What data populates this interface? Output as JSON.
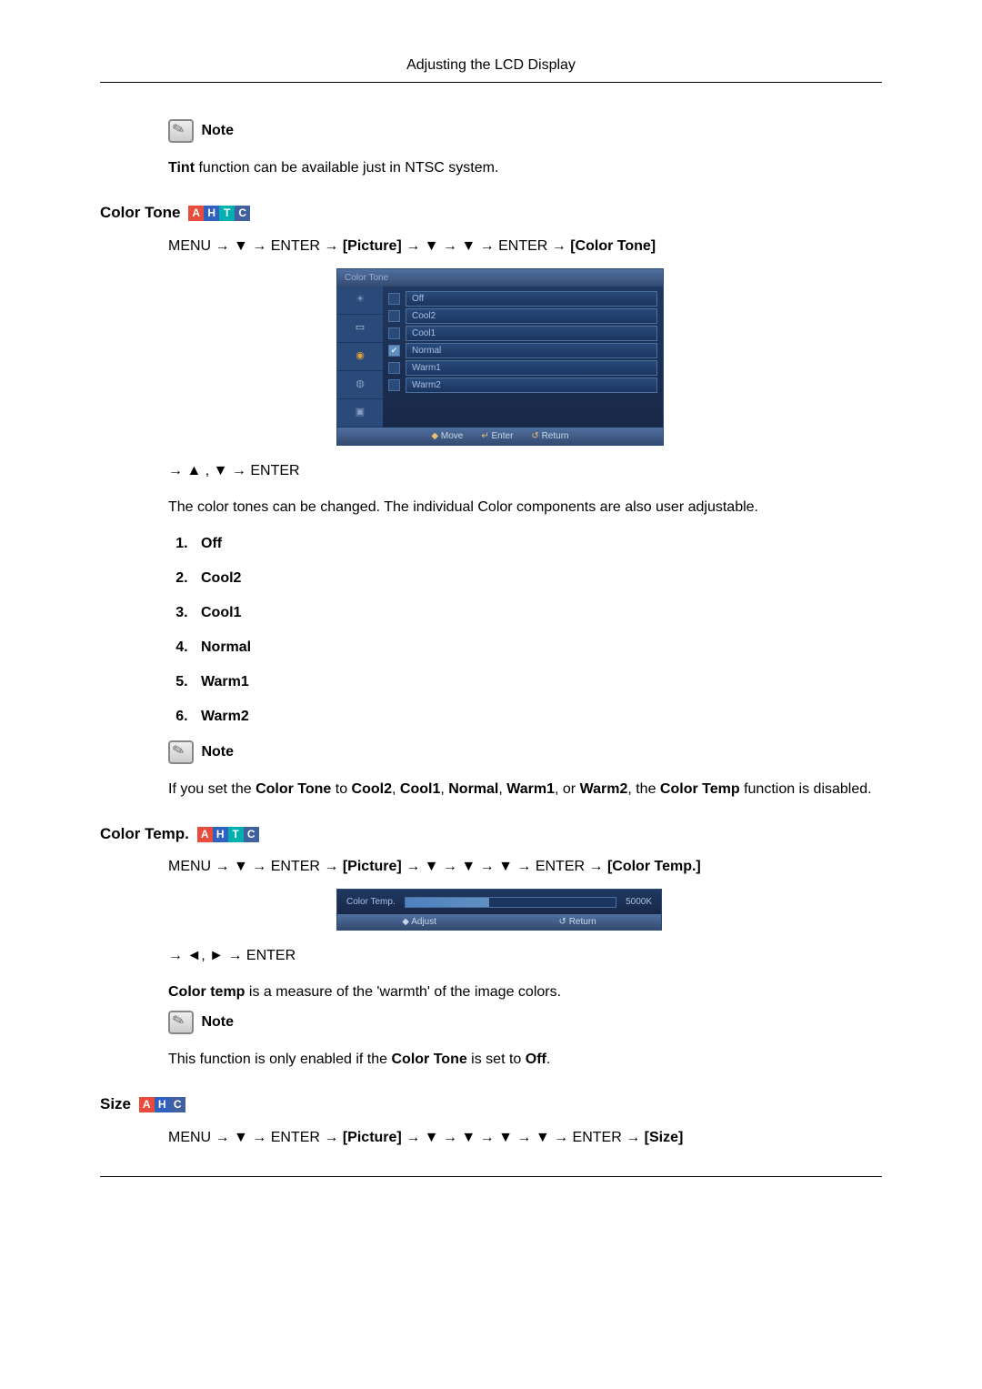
{
  "page_header": "Adjusting the LCD Display",
  "note_label": "Note",
  "tint_note": {
    "bold": "Tint",
    "rest": " function can be available just in NTSC system."
  },
  "badges": {
    "A": "A",
    "H": "H",
    "T": "T",
    "C": "C"
  },
  "color_tone": {
    "title": "Color Tone",
    "path": {
      "pre": "MENU → ▼ → ENTER → ",
      "picture": "[Picture]",
      "mid": " → ▼ → ▼ → ENTER → ",
      "final": "[Color Tone]"
    },
    "osd_title": "Color Tone",
    "options": [
      "Off",
      "Cool2",
      "Cool1",
      "Normal",
      "Warm1",
      "Warm2"
    ],
    "selected_index": 3,
    "footer": {
      "move": "Move",
      "enter": "Enter",
      "return": "Return"
    },
    "post_nav": "→ ▲ , ▼ → ENTER",
    "desc": "The color tones can be changed. The individual Color components are also user adjustable.",
    "list": [
      "Off",
      "Cool2",
      "Cool1",
      "Normal",
      "Warm1",
      "Warm2"
    ],
    "note2_parts": {
      "p0": "If you set the ",
      "p1": "Color Tone",
      "p2": " to ",
      "p3": "Cool2",
      "p4": ", ",
      "p5": "Cool1",
      "p6": ", ",
      "p7": "Normal",
      "p8": ", ",
      "p9": "Warm1",
      "p10": ", or ",
      "p11": "Warm2",
      "p12": ", the ",
      "p13": "Color Temp",
      "p14": " function is disabled."
    }
  },
  "color_temp": {
    "title": "Color Temp.",
    "path": {
      "pre": "MENU → ▼ → ENTER → ",
      "picture": "[Picture]",
      "mid": " → ▼ → ▼ → ▼ → ENTER → ",
      "final": "[Color Temp.]"
    },
    "slider_label": "Color  Temp.",
    "slider_value": "5000K",
    "slider_footer": {
      "adjust": "Adjust",
      "return": "Return"
    },
    "post_nav": "→ ◄, ► → ENTER",
    "desc_bold": "Color temp",
    "desc_rest": " is a measure of the 'warmth' of the image colors.",
    "note_parts": {
      "p0": "This function is only enabled if the ",
      "p1": "Color Tone",
      "p2": " is set to ",
      "p3": "Off",
      "p4": "."
    }
  },
  "size": {
    "title": "Size",
    "path": {
      "pre": "MENU → ▼ → ENTER → ",
      "picture": "[Picture]",
      "mid": " → ▼ → ▼ → ▼ → ▼ → ENTER → ",
      "final": "[Size]"
    }
  },
  "icons": {
    "move_sym": "◆",
    "enter_sym": "↵",
    "return_sym": "↺",
    "adjust_sym": "◆"
  }
}
